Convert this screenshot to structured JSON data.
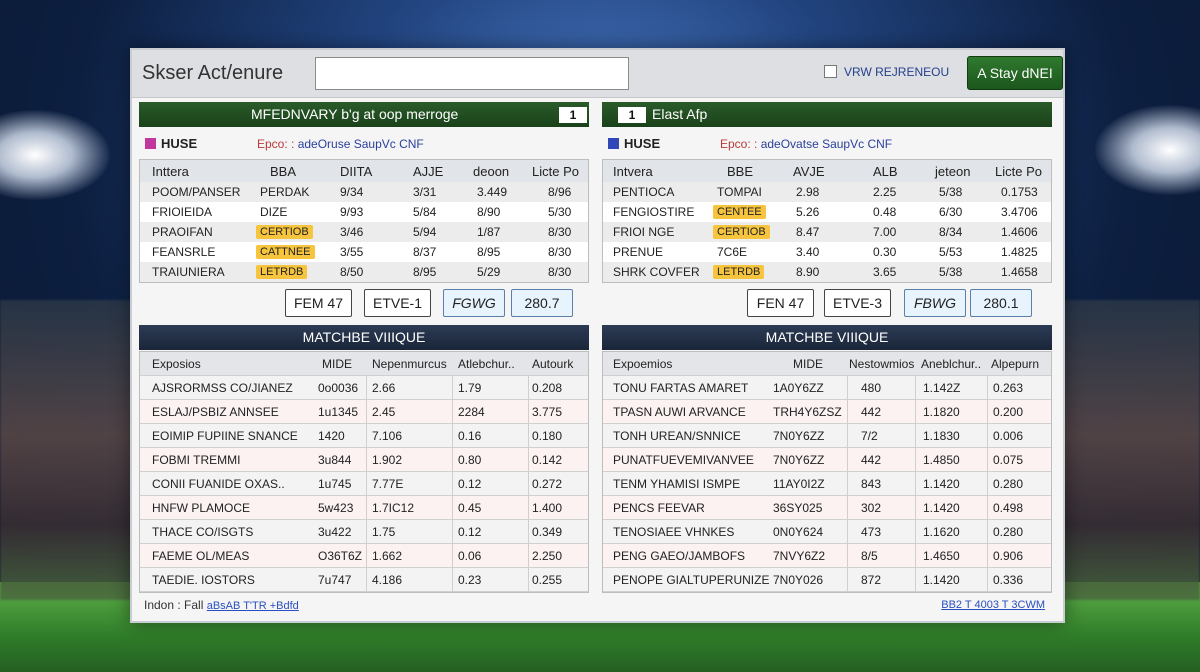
{
  "window": {
    "title": "Skser Act/enure",
    "search_value": "",
    "checkbox_label": "VRW REJRENEOU",
    "stay_button": "A Stay dNEI"
  },
  "panels": [
    {
      "title": "MFEDNVARY b'g at oop merroge",
      "badge": "1",
      "legend": "HUSE",
      "legend_color": "#c0389c",
      "link_prefix": "Epco: :",
      "link": "adeOruse SaupVc CNF",
      "headers": [
        "Inttera",
        "BBA",
        "DIITA",
        "AJJE",
        "deoon",
        "Licte Po"
      ],
      "rows": [
        [
          "POOM/PANSER",
          "PERDAK",
          "9/34",
          "3/31",
          "3.449",
          "8/96"
        ],
        [
          "FRIOIEIDA",
          "DIZE",
          "9/93",
          "5/84",
          "8/90",
          "5/30"
        ],
        [
          "PRAOIFAN",
          "CERTIOB",
          "3/46",
          "5/94",
          "1/87",
          "8/30"
        ],
        [
          "FEANSRLE",
          "CATTNEE",
          "3/55",
          "8/37",
          "8/95",
          "8/30"
        ],
        [
          "TRAIUNIERA",
          "LETRDB",
          "8/50",
          "8/95",
          "5/29",
          "8/30"
        ]
      ],
      "controls": [
        "FEM 47",
        "ETVE-1",
        "FGWG",
        "280.7"
      ]
    },
    {
      "title": "Elast Afp",
      "badge": "1",
      "legend": "HUSE",
      "legend_color": "#3047b8",
      "link_prefix": "Epco: :",
      "link": "adeOvatse SaupVc CNF",
      "headers": [
        "Intvera",
        "BBE",
        "AVJE",
        "ALB",
        "jeteon",
        "Licte Po"
      ],
      "rows": [
        [
          "PENTIOCA",
          "TOMPAI",
          "2.98",
          "2.25",
          "5/38",
          "0.1753"
        ],
        [
          "FENGIOSTIRE",
          "CENTEE",
          "5.26",
          "0.48",
          "6/30",
          "3.4706"
        ],
        [
          "FRIOI NGE",
          "CERTIOB",
          "8.47",
          "7.00",
          "8/34",
          "1.4606"
        ],
        [
          "PRENUE",
          "7C6E",
          "3.40",
          "0.30",
          "5/53",
          "1.4825"
        ],
        [
          "SHRK COVFER",
          "LETRDB",
          "8.90",
          "3.65",
          "5/38",
          "1.4658"
        ]
      ],
      "controls": [
        "FEN 47",
        "ETVE-3",
        "FBWG",
        "280.1"
      ]
    }
  ],
  "matches": [
    {
      "title": "MATCHBE VIIIQUE",
      "headers": [
        "Exposios",
        "MIDE",
        "Nepenmurcus",
        "Atlebchur..",
        "Autourk"
      ],
      "rows": [
        [
          "AJSRORMSS CO/JIANEZ",
          "0o0036",
          "2.66",
          "1.79",
          "0.208"
        ],
        [
          "ESLAJ/PSBIZ ANNSEE",
          "1u1345",
          "2.45",
          "2284",
          "3.775"
        ],
        [
          "EOIMIP FUPIINE SNANCE",
          "1420",
          "7.106",
          "0.16",
          "0.180"
        ],
        [
          "FOBMI TREMMI",
          "3u844",
          "1.902",
          "0.80",
          "0.142"
        ],
        [
          "CONII FUANIDE OXAS..",
          "1u745",
          "7.77E",
          "0.12",
          "0.272"
        ],
        [
          "HNFW PLAMOCE",
          "5w423",
          "1.7IC12",
          "0.45",
          "1.400"
        ],
        [
          "THACE CO/ISGTS",
          "3u422",
          "1.75",
          "0.12",
          "0.349"
        ],
        [
          "FAEME OL/MEAS",
          "O36T6Z",
          "1.662",
          "0.06",
          "2.250"
        ],
        [
          "TAEDIE. IOSTORS",
          "7u747",
          "4.186",
          "0.23",
          "0.255"
        ]
      ]
    },
    {
      "title": "MATCHBE VIIIQUE",
      "headers": [
        "Expoemios",
        "MIDE",
        "Nestowmios",
        "Aneblchur..",
        "Alpepurn"
      ],
      "rows": [
        [
          "TONU FARTAS AMARET",
          "1A0Y6ZZ",
          "480",
          "1.142Z",
          "0.263"
        ],
        [
          "TPASN AUWI ARVANCE",
          "TRH4Y6ZSZ",
          "442",
          "1.1820",
          "0.200"
        ],
        [
          "TONH UREAN/SNNICE",
          "7N0Y6ZZ",
          "7/2",
          "1.1830",
          "0.006"
        ],
        [
          "PUNATFUEVEMIVANVEE",
          "7N0Y6ZZ",
          "442",
          "1.4850",
          "0.075"
        ],
        [
          "TENM YHAMISI ISMPE",
          "11AY0I2Z",
          "843",
          "1.1420",
          "0.280"
        ],
        [
          "PENCS FEEVAR",
          "36SY025",
          "302",
          "1.1420",
          "0.498"
        ],
        [
          "TENOSIAEE VHNKES",
          "0N0Y624",
          "473",
          "1.1620",
          "0.280"
        ],
        [
          "PENG GAEO/JAMBOFS",
          "7NVY6Z2",
          "8/5",
          "1.4650",
          "0.906"
        ],
        [
          "PENOPE GIALTUPERUNIZE",
          "7N0Y026",
          "872",
          "1.1420",
          "0.336"
        ]
      ]
    }
  ],
  "footer": {
    "left_label": "Indon : Fall",
    "left_link": "aBsAB T'TR +Bdfd",
    "right_link": "BB2 T 4003 T 3CWM"
  }
}
